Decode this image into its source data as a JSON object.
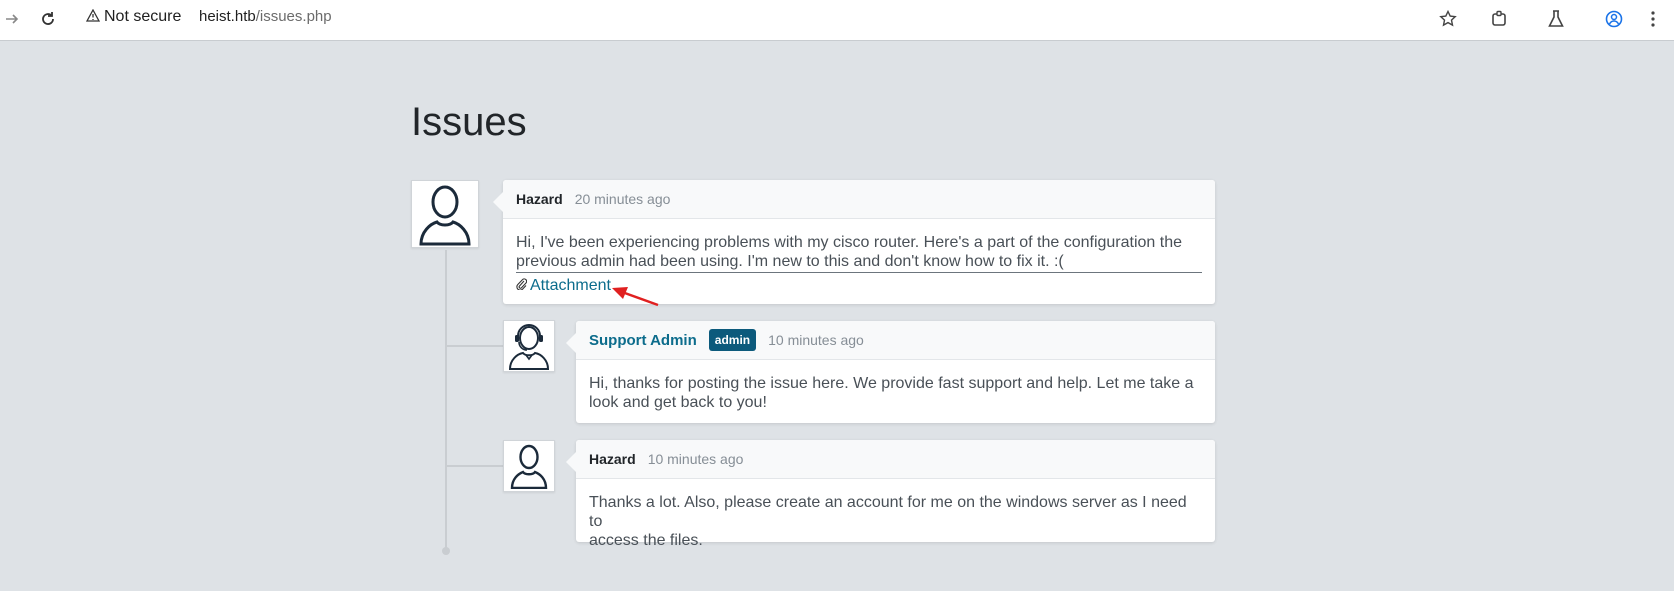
{
  "browser": {
    "security_label": "Not secure",
    "url_host": "heist.htb",
    "url_path": "/issues.php"
  },
  "page": {
    "title": "Issues"
  },
  "issues": [
    {
      "author": "Hazard",
      "time": "20 minutes ago",
      "text_line1": "Hi, I've been experiencing problems with my cisco router. Here's a part of the configuration the",
      "text_line2": "previous admin had been using. I'm new to this and don't know how to fix it. :(",
      "attachment_label": "Attachment",
      "avatar_icon": "user-icon"
    },
    {
      "author": "Support Admin",
      "badge": "admin",
      "time": "10 minutes ago",
      "text_line1": "Hi, thanks for posting the issue here. We provide fast support and help. Let me take a",
      "text_line2": "look and get back to you!",
      "avatar_icon": "support-agent-icon"
    },
    {
      "author": "Hazard",
      "time": "10 minutes ago",
      "text_line1": "Thanks a lot. Also, please create an account for me on the windows server as I need to",
      "text_line2": "access the files.",
      "avatar_icon": "user-icon"
    }
  ],
  "colors": {
    "page_bg": "#dee2e6",
    "accent": "#0c6c8c",
    "badge_bg": "#0c5a7c",
    "annotation_arrow": "#e02020"
  }
}
